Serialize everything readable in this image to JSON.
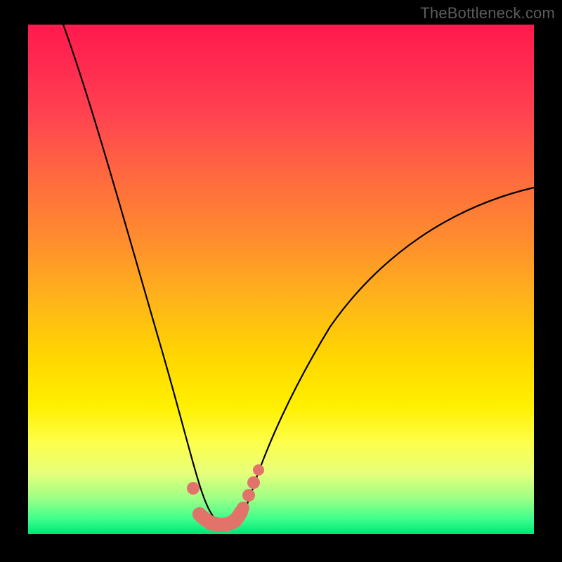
{
  "watermark": "TheBottleneck.com",
  "chart_data": {
    "type": "line",
    "title": "",
    "xlabel": "",
    "ylabel": "",
    "xlim": [
      0,
      100
    ],
    "ylim": [
      0,
      100
    ],
    "grid": false,
    "legend": false,
    "series": [
      {
        "name": "bottleneck-curve",
        "x": [
          7,
          10,
          14,
          18,
          22,
          25,
          28,
          30,
          32,
          33.5,
          35,
          36.5,
          38,
          39.5,
          41,
          43,
          45,
          48,
          52,
          57,
          63,
          70,
          78,
          88,
          100
        ],
        "y": [
          100,
          90,
          78,
          64,
          50,
          38,
          27,
          19,
          12,
          8,
          5,
          3,
          2,
          2.5,
          4,
          7,
          11,
          17,
          25,
          33,
          41,
          49,
          56,
          62,
          67
        ]
      }
    ],
    "markers": [
      {
        "x": 32.5,
        "y": 9
      },
      {
        "x": 34.5,
        "y": 3.3
      },
      {
        "x": 36.0,
        "y": 2.2
      },
      {
        "x": 38.0,
        "y": 2.0
      },
      {
        "x": 40.0,
        "y": 2.3
      },
      {
        "x": 41.5,
        "y": 4.2
      },
      {
        "x": 43.0,
        "y": 7.0
      },
      {
        "x": 44.0,
        "y": 9.5
      },
      {
        "x": 45.0,
        "y": 12.0
      }
    ],
    "colors": {
      "curve": "#000000",
      "marker": "#e2736b",
      "gradient_top": "#ff1a4d",
      "gradient_bottom": "#00e676"
    }
  }
}
